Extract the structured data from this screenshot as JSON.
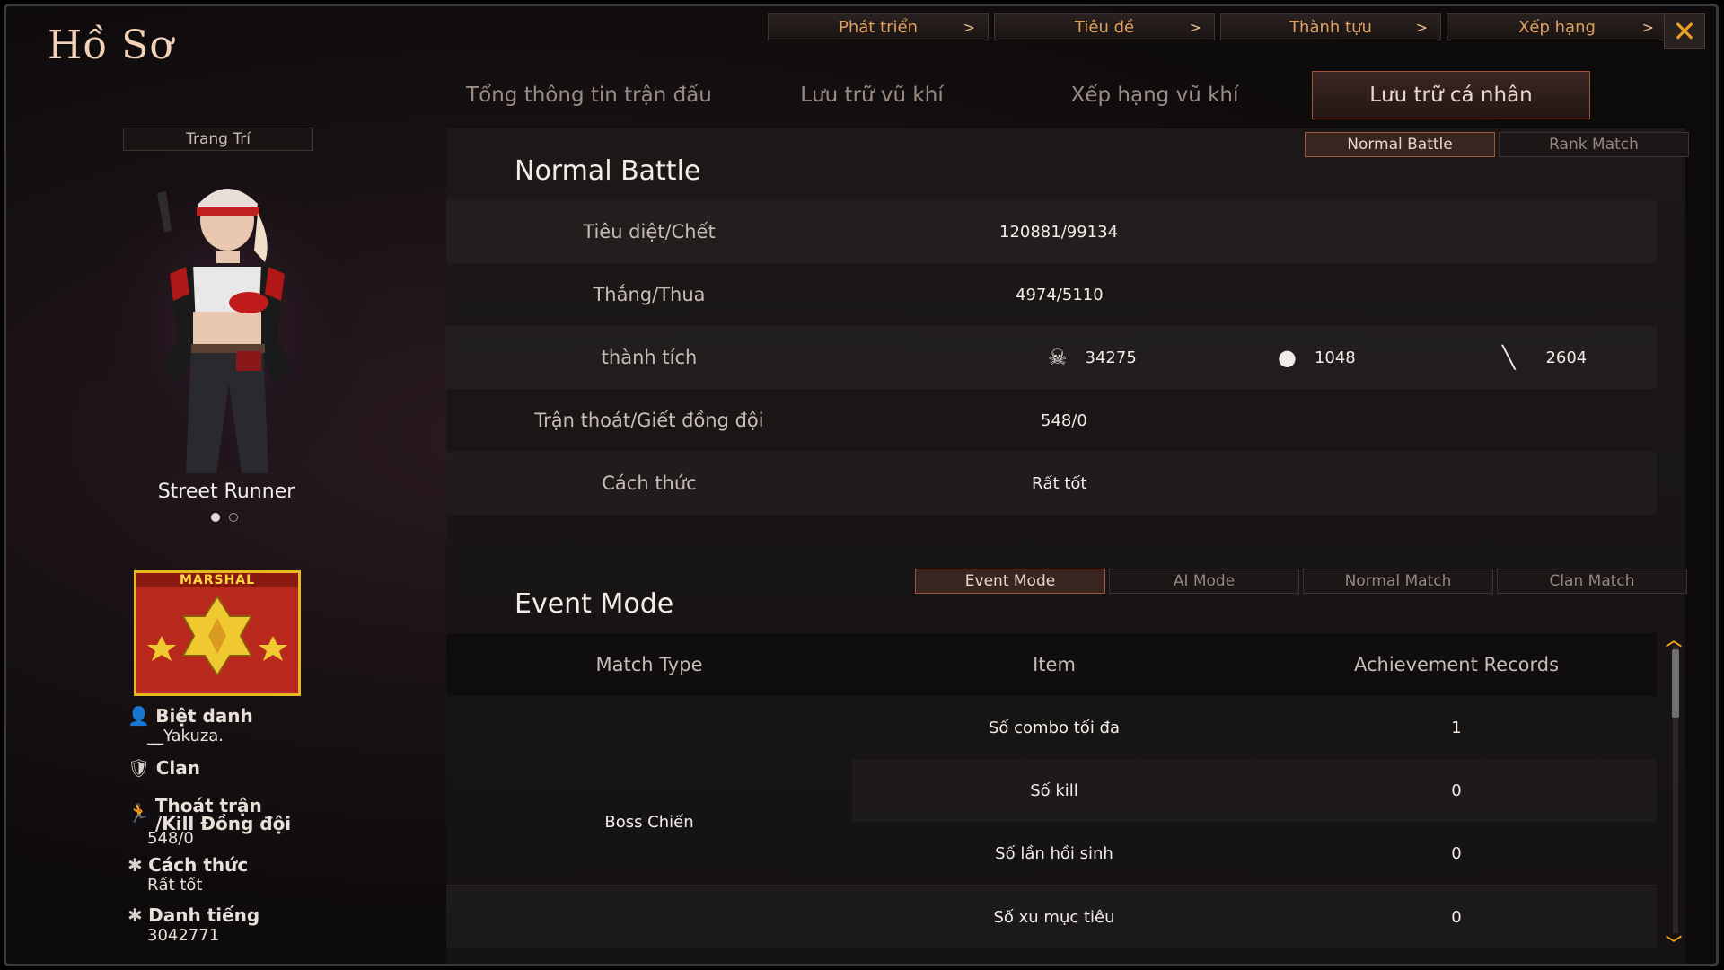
{
  "title": "Hồ Sơ",
  "topnav": [
    {
      "label": "Phát triển"
    },
    {
      "label": "Tiêu đề"
    },
    {
      "label": "Thành tựu"
    },
    {
      "label": "Xếp hạng"
    }
  ],
  "close_glyph": "✕",
  "chevron": ">",
  "tabs": {
    "t1": "Tổng thông tin trận đấu",
    "t2": "Lưu trữ vũ khí",
    "t3": "Xếp hạng vũ khí",
    "t4": "Lưu trữ cá nhân"
  },
  "left": {
    "decorate": "Trang Trí",
    "character_name": "Street Runner",
    "rank_label": "MARSHAL",
    "nickname_label": "Biệt danh",
    "nickname_value": "__Yakuza.",
    "clan_label": "Clan",
    "desert_label_1": "Thoát trận",
    "desert_label_2": "/Kill Đồng đội",
    "desert_value": "548/0",
    "manner_label": "Cách thức",
    "manner_value": "Rất tốt",
    "fame_label": "Danh tiếng",
    "fame_value": "3042771"
  },
  "battle_tabs": {
    "normal": "Normal Battle",
    "rank": "Rank Match"
  },
  "normal": {
    "title": "Normal Battle",
    "kd_label": "Tiêu diệt/Chết",
    "kd_value": "120881/99134",
    "wl_label": "Thắng/Thua",
    "wl_value": "4974/5110",
    "ach_label": "thành tích",
    "ach_headshot": "34275",
    "ach_grenade": "1048",
    "ach_knife": "2604",
    "desert_label": "Trận thoát/Giết đồng đội",
    "desert_value": "548/0",
    "manner_label": "Cách thức",
    "manner_value": "Rất tốt"
  },
  "mode_tabs": {
    "event": "Event Mode",
    "ai": "AI Mode",
    "normal": "Normal Match",
    "clan": "Clan Match"
  },
  "event": {
    "title": "Event Mode",
    "headers": {
      "type": "Match Type",
      "item": "Item",
      "records": "Achievement Records"
    },
    "match_type": "Boss Chiến",
    "rows": [
      {
        "item": "Số combo tối đa",
        "value": "1"
      },
      {
        "item": "Số kill",
        "value": "0"
      },
      {
        "item": "Số lần hồi sinh",
        "value": "0"
      },
      {
        "item": "Số xu mục tiêu",
        "value": "0"
      }
    ]
  },
  "colors": {
    "accent": "#f0a020",
    "active_border": "#a0563a",
    "rank_red": "#b8281c",
    "rank_gold": "#e8b820"
  }
}
